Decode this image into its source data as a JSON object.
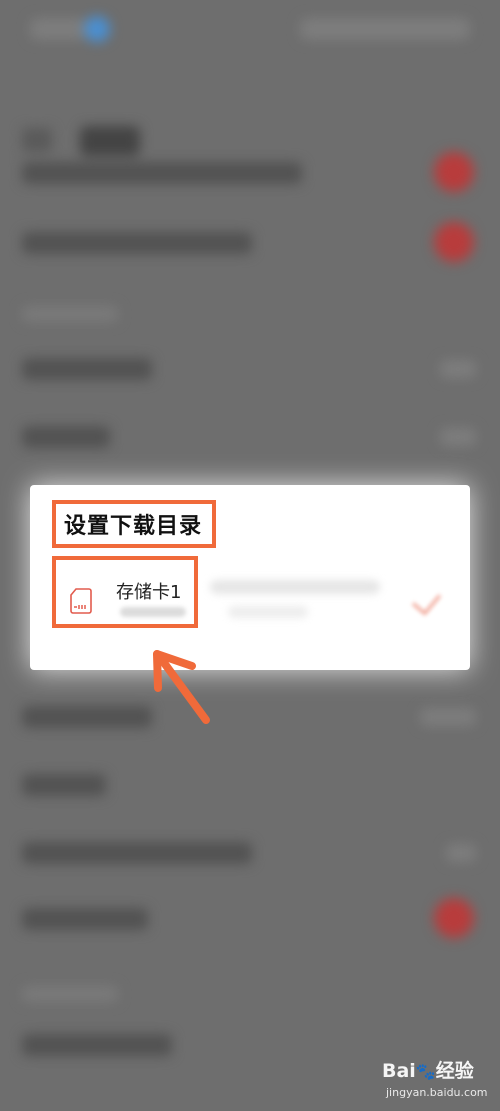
{
  "dialog": {
    "title": "设置下载目录",
    "storage_option": {
      "label": "存储卡1"
    }
  },
  "watermark": {
    "logo_text": "Bai",
    "logo_suffix": "经验",
    "url": "jingyan.baidu.com"
  },
  "icons": {
    "storage": "sd-card-icon",
    "annotation": "arrow-icon"
  },
  "colors": {
    "highlight": "#f06a3a",
    "toggle_on": "#b83c3c",
    "background": "#6e6e6e"
  }
}
